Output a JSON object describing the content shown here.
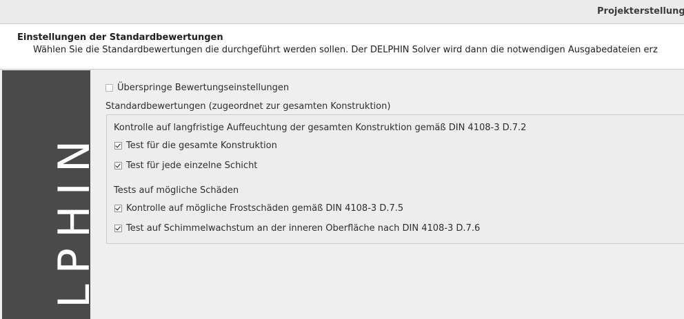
{
  "window": {
    "title": "Projekterstellungs"
  },
  "header": {
    "title": "Einstellungen der Standardbewertungen",
    "subtitle": "Wählen Sie die Standardbewertungen die durchgeführt werden sollen. Der DELPHIN Solver wird dann die notwendigen Ausgabedateien erz"
  },
  "sidebar": {
    "banner_text": "LPHIN"
  },
  "main": {
    "skip_checkbox": {
      "label": "Überspringe Bewertungseinstellungen",
      "checked": false
    },
    "group_title": "Standardbewertungen (zugeordnet zur gesamten Konstruktion)",
    "section1": {
      "title": "Kontrolle auf langfristige Auffeuchtung der gesamten Konstruktion gemäß DIN 4108-3 D.7.2",
      "items": [
        {
          "label": "Test für die gesamte Konstruktion",
          "checked": true
        },
        {
          "label": "Test für jede einzelne Schicht",
          "checked": true
        }
      ]
    },
    "section2": {
      "title": "Tests auf mögliche Schäden",
      "items": [
        {
          "label": "Kontrolle auf mögliche Frostschäden gemäß DIN 4108-3 D.7.5",
          "checked": true
        },
        {
          "label": "Test auf Schimmelwachstum an der inneren Oberfläche nach DIN 4108-3 D.7.6",
          "checked": true
        }
      ]
    }
  }
}
